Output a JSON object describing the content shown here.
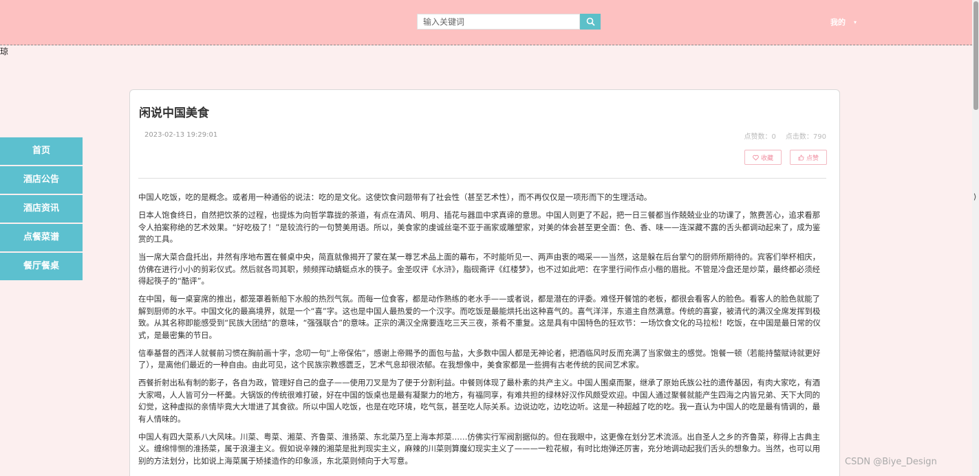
{
  "header": {
    "search_placeholder": "输入关键词",
    "user_label": "我的",
    "user_caret": "▾"
  },
  "stray_glyph": "琼",
  "sidebar": {
    "items": [
      {
        "label": "首页"
      },
      {
        "label": "酒店公告"
      },
      {
        "label": "酒店资讯"
      },
      {
        "label": "点餐菜谱"
      },
      {
        "label": "餐厅餐桌"
      }
    ]
  },
  "article": {
    "title": "闲说中国美食",
    "date": "2023-02-13 19:29:01",
    "likes": "点赞数：0",
    "clicks": "点击数：790",
    "favorite_label": "收藏",
    "like_label": "点赞",
    "paragraphs": [
      "中国人吃饭，吃的是概念。或者用一种通俗的说法：吃的是文化。这使饮食问题带有了社会性（甚至艺术性），而不再仅仅是一项形而下的生理活动。",
      "日本人饱食终日，自然把饮茶的过程，也提炼为向哲学靠拢的茶道，有点在清风、明月、插花与器皿中求真谛的意思。中国人则更了不起，把一日三餐都当作兢兢业业的功课了，煞费苦心，追求看那令人拍案称绝的艺术效果。“好吃极了！”是较流行的一句赞美用语。所以，美食家的虔诚丝毫不亚于画家或雕塑家，对美的体会甚至更全面：色、香、味——连深藏不露的舌头都调动起来了，成为鉴赏的工具。",
      "当一席大菜合盘托出，井然有序地布置在餐桌中央，简直就像揭开了蒙在某一尊艺术品上面的幕布，不时能听见一、两声由衷的喝采——当然，这是躲在后台掌勺的厨师所期待的。宾客们举杯相庆，仿佛在进行小小的剪彩仪式。然后就各司其职，频频挥动蜻蜓点水的筷子。金圣叹评《水浒》，脂砚斋评《红楼梦》，也不过如此吧：在字里行间作点小楷的眉批。不管是冷盘还是炒菜，最终都必须经得起筷子的“酷评”。",
      "在中国，每一桌宴席的推出，都笼罩着新船下水般的热烈气氛。而每一位食客，都是动作熟练的老水手——或者说，都是潜在的评委。难怪开餐馆的老板，都很会看客人的脸色。看客人的脸色就能了解到厨师的水平。中国文化的最高境界，就是一个“喜”字。这也是中国人最热爱的一个汉字。而吃饭是最能烘托出这种喜气的。喜气洋洋，东道主自然满意。传统的喜宴，被清代的满汉全席发挥到极致。从其名称即能感受到“民族大团结”的意味，“强强联合”的意味。正宗的满汉全席要连吃三天三夜，茶肴不重复。这是具有中国特色的狂欢节：一场饮食文化的马拉松！吃饭，在中国是最日常的仪式，是最密集的节日。",
      "信奉基督的西洋人就餐前习惯在胸前画十字，念叨一句“上帝保佑”，感谢上帝赐予的面包与盐，大多数中国人都是无神论者，把酒临风时反而充满了当家做主的感觉。饱餐一顿（若能持螯赋诗就更好了），是离他们最近的一种自由。由此可见，这个民族宗教感匮乏，艺术气息却很浓郁。在我想像中，美食家都是一些拥有古老传统的民间艺术家。",
      "西餐折射出私有制的影子，各自为政，管理好自己的盘子——使用刀叉是为了便于分割利益。中餐则体现了最朴素的共产主义。中国人围桌而聚，继承了原始氏族公社的遗传基因，有肉大家吃，有酒大家喝，人人皆可分一杯羹。大锅饭的传统很难打破，好在中国的饭桌也是最有凝聚力的地方，有福同享，有难共担的绿林好汉作风颇受欢迎。中国人通过聚餐就能产生四海之内皆兄弟、天下大同的幻觉，这种虚拟的亲情毕竟大大增进了其食欲。所以中国人吃饭，也是在吃环境，吃气氛，甚至吃人际关系。边说边吃，边吃边听。这是一种超越了吃的吃。我一直认为中国人的吃是最有情调的，最有人情味的。",
      "中国人有四大菜系八大风味。川菜、粤菜、湘菜、齐鲁菜、淮扬菜、东北菜乃至上海本邦菜……仿佛实行军阀割据似的。但在我眼中，这更像在划分艺术流派。出自圣人之乡的齐鲁菜，称得上古典主义。缠绵悱恻的淮扬菜，属于浪漫主义。假如说辛辣的湘菜是批判现实主义，麻辣的川菜则算魔幻现实主义了———一粒花椒，有时比炮弹还厉害，充分地调动起我们舌头的想象力。当然，也可以用别的方法划分，比如说上海菜属于矫揉造作的印象派，东北菜则倾向于大写意。"
    ]
  },
  "watermark": "CSDN @Biye_Design",
  "colors": {
    "header_bg": "#fdc1c1",
    "accent": "#5cc0cf",
    "page_bg": "#fcefef"
  }
}
